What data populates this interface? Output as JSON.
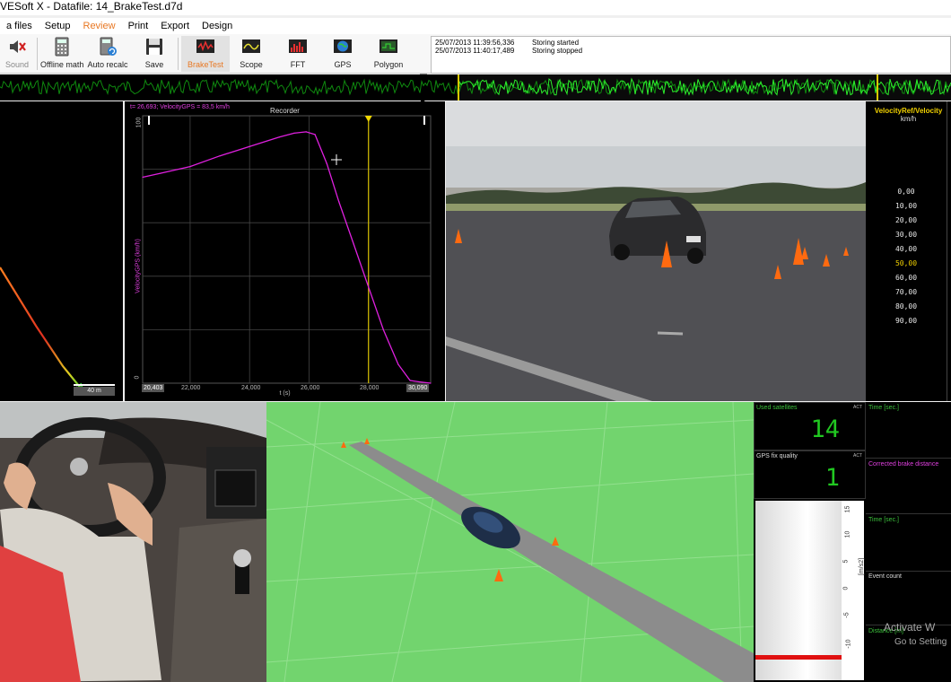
{
  "window": {
    "title": "VESoft X - Datafile: 14_BrakeTest.d7d"
  },
  "menu": [
    {
      "label": "a files",
      "active": false
    },
    {
      "label": "Setup",
      "active": false
    },
    {
      "label": "Review",
      "active": true
    },
    {
      "label": "Print",
      "active": false
    },
    {
      "label": "Export",
      "active": false
    },
    {
      "label": "Design",
      "active": false
    }
  ],
  "toolbar": {
    "sound": "Sound",
    "offline_math": "Offline math",
    "auto_recalc": "Auto recalc",
    "save": "Save",
    "braketest": "BrakeTest",
    "scope": "Scope",
    "fft": "FFT",
    "gps": "GPS",
    "polygon": "Polygon"
  },
  "log": [
    {
      "time": "25/07/2013 11:39:56,336",
      "message": "Storing started"
    },
    {
      "time": "25/07/2013 11:40:17,489",
      "message": "Storing stopped"
    }
  ],
  "gps_track": {
    "scale_label": "40 m"
  },
  "recorder": {
    "title": "Recorder",
    "readout": "t= 26,693; VelocityGPS = 83,5 km/h",
    "ylabel": "VelocityGPS (km/h)",
    "xlabel": "t (s)",
    "y_top_tick": "100",
    "y_bottom_tick": "0",
    "x_start": "20,403",
    "x_end": "30,090",
    "x_ticks": [
      "22,000",
      "24,000",
      "26,000",
      "28,000"
    ]
  },
  "chart_data": {
    "type": "line",
    "title": "Recorder",
    "xlabel": "t (s)",
    "ylabel": "VelocityGPS (km/h)",
    "xlim": [
      20.403,
      30.09
    ],
    "ylim": [
      0,
      100
    ],
    "cursor_x": 28.0,
    "series": [
      {
        "name": "VelocityGPS",
        "color": "#e020e0",
        "x": [
          20.403,
          21.0,
          22.0,
          23.0,
          24.0,
          25.0,
          25.5,
          25.9,
          26.2,
          26.6,
          27.0,
          27.5,
          28.0,
          28.5,
          29.0,
          29.4,
          29.7,
          30.09
        ],
        "y": [
          77,
          78.5,
          81,
          85,
          88.5,
          92,
          93.5,
          94,
          93,
          82,
          68,
          52,
          36,
          20,
          7,
          1,
          0.5,
          0
        ]
      }
    ]
  },
  "velocity_table": {
    "header": "VelocityRef/Velocity",
    "unit": "km/h",
    "rows": [
      "0,00",
      "10,00",
      "20,00",
      "30,00",
      "40,00",
      "50,00",
      "60,00",
      "70,00",
      "80,00",
      "90,00"
    ],
    "highlight_index": 5
  },
  "digits": {
    "satellites_label": "Used satellites",
    "satellites_value": "14",
    "fix_label": "GPS fix quality",
    "fix_value": "1",
    "act": "ACT"
  },
  "gauge": {
    "ticks": [
      "15",
      "10",
      "5",
      "0",
      "-5",
      "-10"
    ],
    "unit": "[m/s2]"
  },
  "right_lower": {
    "time_label_1": "Time [sec.]",
    "corrected_label": "Corrected brake distance",
    "time_label_2": "Time [sec.]",
    "event_count": "Event count",
    "distance_label": "Distance [m]"
  },
  "watermark": {
    "line1": "Activate W",
    "line2": "Go to Setting"
  },
  "colors": {
    "accent": "#e87722",
    "trace": "#e020e0",
    "digits": "#21c721",
    "table_header": "#f0d000",
    "ground": "#72d46e"
  }
}
